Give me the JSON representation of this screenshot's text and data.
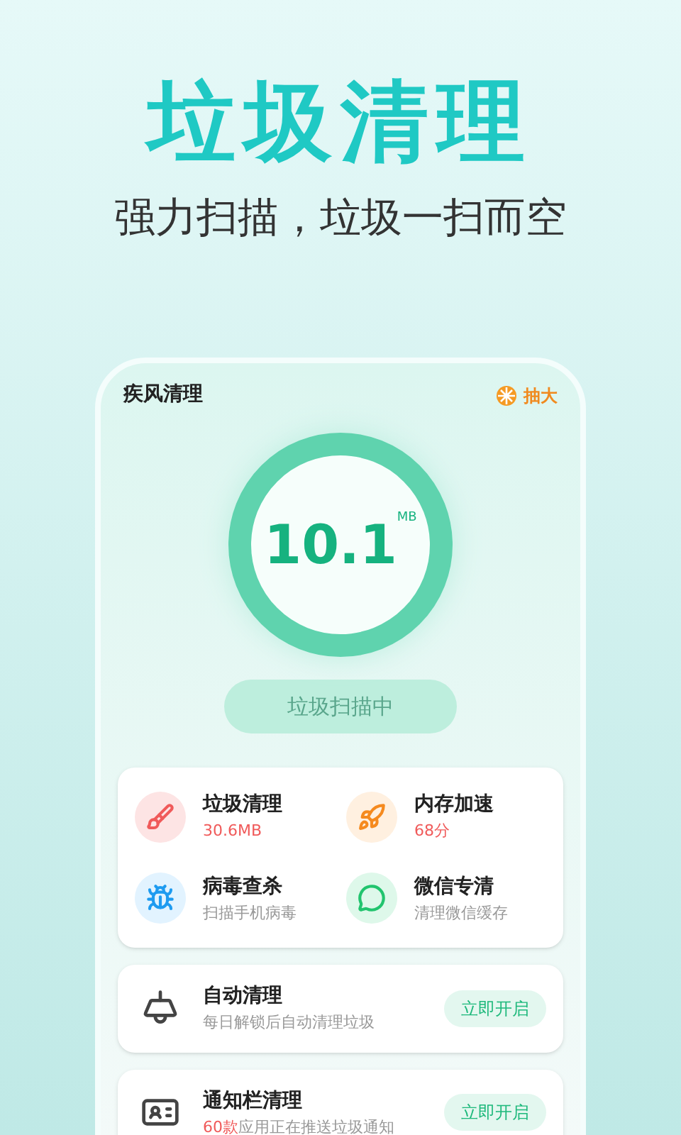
{
  "headline": "垃圾清理",
  "tagline": "强力扫描，垃圾一扫而空",
  "app": {
    "title": "疾风清理",
    "promo": "抽大"
  },
  "scan": {
    "value": "10.1",
    "unit": "MB",
    "button": "垃圾扫描中",
    "disabled": true
  },
  "features": [
    {
      "kind": "junk",
      "title": "垃圾清理",
      "subtitle": "30.6MB",
      "alert": true
    },
    {
      "kind": "memory",
      "title": "内存加速",
      "subtitle": "68分",
      "alert": true
    },
    {
      "kind": "virus",
      "title": "病毒查杀",
      "subtitle": "扫描手机病毒",
      "alert": false
    },
    {
      "kind": "wechat",
      "title": "微信专清",
      "subtitle": "清理微信缓存",
      "alert": false
    }
  ],
  "tasks": [
    {
      "kind": "auto",
      "title": "自动清理",
      "subtitle": "每日解锁后自动清理垃圾",
      "action": "立即开启"
    },
    {
      "kind": "notify",
      "title": "通知栏清理",
      "highlight": "60款",
      "subtitle": "应用正在推送垃圾通知",
      "action": "立即开启"
    }
  ]
}
